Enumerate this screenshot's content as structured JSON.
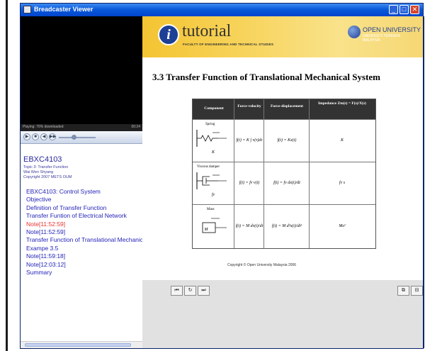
{
  "window": {
    "title": "Breadcaster Viewer",
    "min": "_",
    "max": "□",
    "close": "✕"
  },
  "player": {
    "status": "Playing: 76% downloaded",
    "time": "00:24",
    "controls": {
      "play": "▶",
      "stop": "■",
      "rewind": "◀",
      "forward": "▶▶",
      "volume": "●"
    },
    "bottom_buttons": [
      "⏮",
      "↻",
      "⏭"
    ],
    "right_buttons": [
      "⧉",
      "⊟"
    ]
  },
  "course": {
    "code": "EBXC4103",
    "topic": "Topic 3: Transfer Function",
    "author": "Wai Wen Shyang",
    "copyright": "Copyright 2007 METS OUM"
  },
  "toc": [
    {
      "label": "EBXC4103: Control System",
      "active": false
    },
    {
      "label": "Objective",
      "active": false
    },
    {
      "label": "Definition of Transfer Function",
      "active": false
    },
    {
      "label": "Transfer Funtion of Electrical Network",
      "active": false
    },
    {
      "label": "Note[11:52:59]",
      "active": true
    },
    {
      "label": "Note[11:52:59]",
      "active": false
    },
    {
      "label": "Transfer Function of Translational Mechanica",
      "active": false
    },
    {
      "label": "Exampe 3.5",
      "active": false
    },
    {
      "label": "Note[11:59:18]",
      "active": false
    },
    {
      "label": "Note[12:03:12]",
      "active": false
    },
    {
      "label": "Summary",
      "active": false
    }
  ],
  "slide": {
    "banner": {
      "badge": "i",
      "word": "tutorial",
      "sub": "FACULTY OF ENGINEERING AND TECHNICAL STUDIES",
      "ou_name": "OPEN UNIVERSITY",
      "ou_sub1": "UNIVERSITI TERBUKA",
      "ou_sub2": "MALAYSIA"
    },
    "title": "3.3  Transfer Function of Translational Mechanical System",
    "table": {
      "headers": [
        "Component",
        "Force-velocity",
        "Force-displacement",
        "Impedance Zm(s) = F(s)/X(s)"
      ],
      "rows": [
        {
          "component": "Spring",
          "param": "K",
          "velocity": "f(t) = K ∫ v(τ)dτ",
          "displacement": "f(t) = Kx(t)",
          "impedance": "K"
        },
        {
          "component": "Viscous damper",
          "param": "fv",
          "velocity": "f(t) = fv v(t)",
          "displacement": "f(t) = fv dx(t)/dt",
          "impedance": "fv s"
        },
        {
          "component": "Mass",
          "param": "M",
          "velocity": "f(t) = M dv(t)/dt",
          "displacement": "f(t) = M d²x(t)/dt²",
          "impedance": "Ms²"
        }
      ]
    },
    "copyright": "Copyright © Open University Malaysia 2006"
  }
}
